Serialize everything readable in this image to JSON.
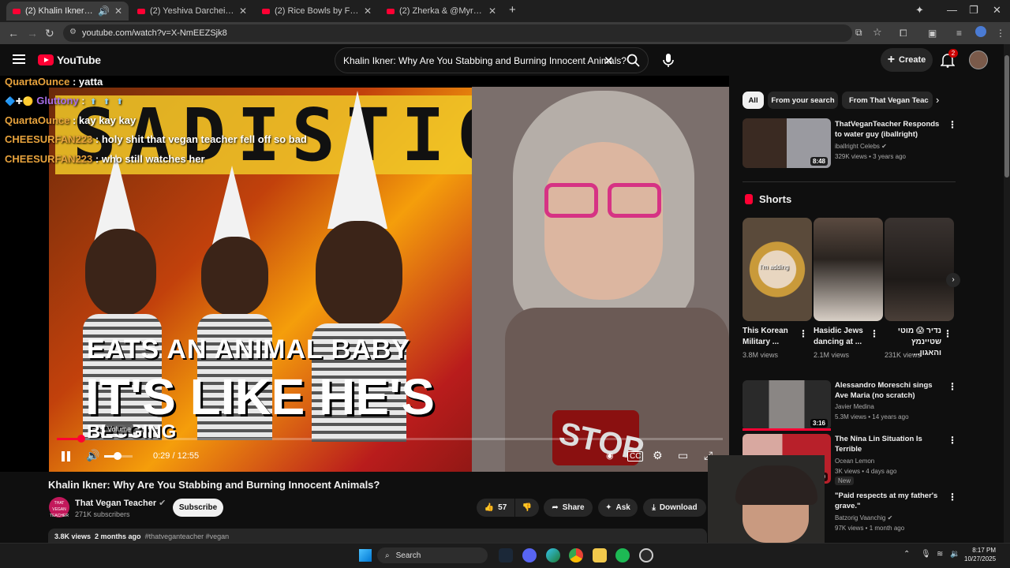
{
  "browser": {
    "tabs": [
      {
        "title": "(2) Khalin Ikner: Why Are Yo",
        "active": true
      },
      {
        "title": "(2) Yeshiva Darchei Torah Choi",
        "active": false
      },
      {
        "title": "(2) Rice Bowls by Flavor Hive - Y",
        "active": false
      },
      {
        "title": "(2) Zherka & @MyronGainesX |",
        "active": false
      }
    ],
    "new_tab": "+",
    "url": "youtube.com/watch?v=X-NmEEZSjk8"
  },
  "youtube": {
    "logo_text": "YouTube",
    "search_query": "Khalin Ikner: Why Are You Stabbing and Burning Innocent Animals?",
    "create_label": "Create",
    "notification_count": "2"
  },
  "player": {
    "chat": [
      {
        "name": "QuartaOunce",
        "message": "yatta",
        "color": "#e8a33d"
      },
      {
        "name": "Gluttony",
        "message": "",
        "color": "#a86ee8"
      },
      {
        "name": "QuartaOunce",
        "message": "kay kay kay",
        "color": "#e8a33d"
      },
      {
        "name": "CHEESURFAN223",
        "message": "holy shit that vegan teacher fell off so bad",
        "color": "#e8a33d"
      },
      {
        "name": "CHEESURFAN223",
        "message": "who still watches her",
        "color": "#e8a33d"
      }
    ],
    "thumbnail_text": {
      "banner": "SADISTIC",
      "line1": "EATS AN ANIMAL BABY",
      "line2": "IT'S LIKE HE'S",
      "line3": "BEGGING",
      "sign": "STOP"
    },
    "volume_tooltip": "Volume",
    "time": "0:29 / 12:55",
    "progress_fraction": 0.037,
    "volume_fraction": 0.4
  },
  "video": {
    "title": "Khalin Ikner: Why Are You Stabbing and Burning Innocent Animals?",
    "channel": "That Vegan Teacher",
    "channel_avatar_text": "THAT VEGAN TEACHER",
    "subscribers": "271K subscribers",
    "subscribe_label": "Subscribe",
    "likes": "57",
    "share_label": "Share",
    "ask_label": "Ask",
    "download_label": "Download",
    "views": "3.8K views",
    "age": "2 months ago",
    "tags": "#thatveganteacher #vegan"
  },
  "sidebar": {
    "chips": [
      "All",
      "From your search",
      "From That Vegan Teac"
    ],
    "top_rec": {
      "title": "ThatVeganTeacher Responds to water guy (iballright)",
      "channel": "iballright Celebs",
      "stats": "329K views • 3 years ago",
      "duration": "8:48"
    },
    "shorts_heading": "Shorts",
    "shorts": [
      {
        "title": "This Korean Military ...",
        "views": "3.8M views",
        "overlay": "I'm adding"
      },
      {
        "title": "Hasidic Jews dancing at ...",
        "views": "2.1M views",
        "overlay": ""
      },
      {
        "title": "נדיר 😱 מוטי שטיינמץ והאגון...",
        "views": "231K views",
        "overlay": ""
      }
    ],
    "recs": [
      {
        "title": "Alessandro Moreschi sings Ave Maria (no scratch)",
        "channel": "Javier Medina",
        "stats": "5.3M views • 14 years ago",
        "duration": "3:16"
      },
      {
        "title": "The Nina Lin Situation Is Terrible",
        "channel": "Ocean Lemon",
        "stats": "3K views • 4 days ago",
        "duration": "15:00",
        "badge": "New"
      },
      {
        "title": "\"Paid respects at my father's grave.\"",
        "channel": "Batzorig Vaanchig",
        "stats": "97K views • 1 month ago",
        "duration": ""
      }
    ]
  },
  "taskbar": {
    "search_label": "Search",
    "time": "8:17 PM",
    "date": "10/27/2025"
  }
}
